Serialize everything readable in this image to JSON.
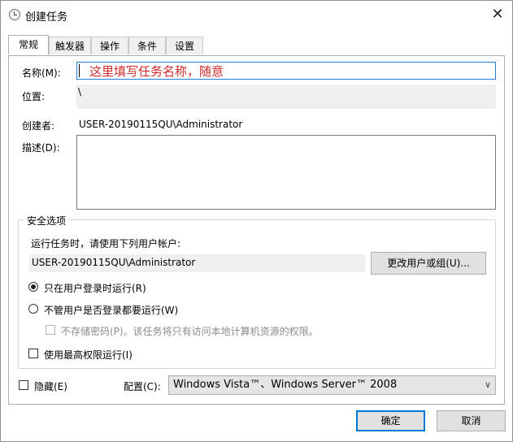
{
  "window": {
    "title": "创建任务",
    "close_glyph": "✕"
  },
  "tabs": [
    {
      "label": "常规",
      "active": true
    },
    {
      "label": "触发器",
      "active": false
    },
    {
      "label": "操作",
      "active": false
    },
    {
      "label": "条件",
      "active": false
    },
    {
      "label": "设置",
      "active": false
    }
  ],
  "general": {
    "name_label": "名称(M):",
    "name_value": "这里填写任务名称，随意",
    "location_label": "位置:",
    "location_value": "\\",
    "author_label": "创建者:",
    "author_value": "USER-20190115QU\\Administrator",
    "description_label": "描述(D):",
    "description_value": ""
  },
  "security": {
    "group_title": "安全选项",
    "run_as_prompt": "运行任务时，请使用下列用户帐户:",
    "user_account": "USER-20190115QU\\Administrator",
    "change_user_button": "更改用户或组(U)...",
    "radio_logged_on": "只在用户登录时运行(R)",
    "radio_logged_on_checked": true,
    "radio_whether_logged": "不管用户是否登录都要运行(W)",
    "radio_whether_logged_checked": false,
    "no_store_password": "不存储密码(P)。该任务将只有访问本地计算机资源的权限。",
    "no_store_password_checked": false,
    "highest_privileges": "使用最高权限运行(I)",
    "highest_privileges_checked": false
  },
  "bottom": {
    "hidden_label": "隐藏(E)",
    "hidden_checked": false,
    "config_label": "配置(C):",
    "config_value": "Windows Vista™、Windows Server™ 2008",
    "config_arrow": "∨"
  },
  "buttons": {
    "ok": "确定",
    "cancel": "取消"
  },
  "colors": {
    "accent": "#0078d7",
    "placeholder_text": "#d02a2a",
    "disabled_text": "#8a8a8a"
  },
  "icons": {
    "title": "clock-icon",
    "close": "close-icon",
    "dropdown": "chevron-down-icon"
  }
}
